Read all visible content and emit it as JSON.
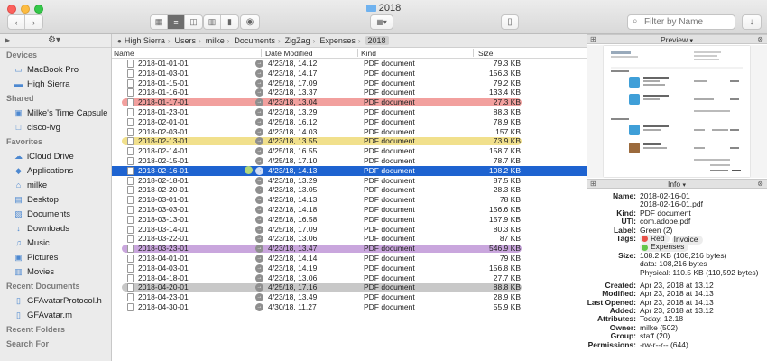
{
  "window": {
    "title": "2018"
  },
  "toolbar": {
    "search_placeholder": "Filter by Name"
  },
  "sidebar": {
    "sections": [
      {
        "title": "Devices",
        "items": [
          {
            "label": "MacBook Pro",
            "icon": "laptop-icon"
          },
          {
            "label": "High Sierra",
            "icon": "disk-icon"
          }
        ]
      },
      {
        "title": "Shared",
        "items": [
          {
            "label": "Milke's Time Capsule",
            "icon": "time-capsule-icon"
          },
          {
            "label": "cisco-lvg",
            "icon": "display-icon"
          }
        ]
      },
      {
        "title": "Favorites",
        "items": [
          {
            "label": "iCloud Drive",
            "icon": "cloud-icon"
          },
          {
            "label": "Applications",
            "icon": "applications-icon"
          },
          {
            "label": "milke",
            "icon": "home-icon"
          },
          {
            "label": "Desktop",
            "icon": "desktop-icon"
          },
          {
            "label": "Documents",
            "icon": "documents-icon"
          },
          {
            "label": "Downloads",
            "icon": "downloads-icon"
          },
          {
            "label": "Music",
            "icon": "music-icon"
          },
          {
            "label": "Pictures",
            "icon": "pictures-icon"
          },
          {
            "label": "Movies",
            "icon": "movies-icon"
          }
        ]
      },
      {
        "title": "Recent Documents",
        "items": [
          {
            "label": "GFAvatarProtocol.h",
            "icon": "file-icon"
          },
          {
            "label": "GFAvatar.m",
            "icon": "file-icon"
          }
        ]
      },
      {
        "title": "Recent Folders",
        "items": []
      },
      {
        "title": "Search For",
        "items": []
      }
    ]
  },
  "breadcrumb": [
    "High Sierra",
    "Users",
    "milke",
    "Documents",
    "ZigZag",
    "Expenses",
    "2018"
  ],
  "columns": {
    "name": "Name",
    "date": "Date Modified",
    "kind": "Kind",
    "size": "Size"
  },
  "files": [
    {
      "name": "2018-01-01-01",
      "date": "4/23/18, 14.12",
      "kind": "PDF document",
      "size": "79.3 KB"
    },
    {
      "name": "2018-01-03-01",
      "date": "4/23/18, 14.17",
      "kind": "PDF document",
      "size": "156.3 KB"
    },
    {
      "name": "2018-01-15-01",
      "date": "4/25/18, 17.09",
      "kind": "PDF document",
      "size": "79.2 KB"
    },
    {
      "name": "2018-01-16-01",
      "date": "4/23/18, 13.37",
      "kind": "PDF document",
      "size": "133.4 KB"
    },
    {
      "name": "2018-01-17-01",
      "date": "4/23/18, 13.04",
      "kind": "PDF document",
      "size": "27.3 KB",
      "label": "red"
    },
    {
      "name": "2018-01-23-01",
      "date": "4/23/18, 13.29",
      "kind": "PDF document",
      "size": "88.3 KB"
    },
    {
      "name": "2018-02-01-01",
      "date": "4/25/18, 16.12",
      "kind": "PDF document",
      "size": "78.9 KB"
    },
    {
      "name": "2018-02-03-01",
      "date": "4/23/18, 14.03",
      "kind": "PDF document",
      "size": "157 KB"
    },
    {
      "name": "2018-02-13-01",
      "date": "4/23/18, 13.55",
      "kind": "PDF document",
      "size": "73.9 KB",
      "label": "yellow"
    },
    {
      "name": "2018-02-14-01",
      "date": "4/25/18, 16.55",
      "kind": "PDF document",
      "size": "158.7 KB"
    },
    {
      "name": "2018-02-15-01",
      "date": "4/25/18, 17.10",
      "kind": "PDF document",
      "size": "78.7 KB"
    },
    {
      "name": "2018-02-16-01",
      "date": "4/23/18, 14.13",
      "kind": "PDF document",
      "size": "108.2 KB",
      "selected": true,
      "label": "green"
    },
    {
      "name": "2018-02-18-01",
      "date": "4/23/18, 13.29",
      "kind": "PDF document",
      "size": "87.5 KB"
    },
    {
      "name": "2018-02-20-01",
      "date": "4/23/18, 13.05",
      "kind": "PDF document",
      "size": "28.3 KB"
    },
    {
      "name": "2018-03-01-01",
      "date": "4/23/18, 14.13",
      "kind": "PDF document",
      "size": "78 KB"
    },
    {
      "name": "2018-03-03-01",
      "date": "4/23/18, 14.18",
      "kind": "PDF document",
      "size": "156.6 KB"
    },
    {
      "name": "2018-03-13-01",
      "date": "4/25/18, 16.58",
      "kind": "PDF document",
      "size": "157.9 KB"
    },
    {
      "name": "2018-03-14-01",
      "date": "4/25/18, 17.09",
      "kind": "PDF document",
      "size": "80.3 KB"
    },
    {
      "name": "2018-03-22-01",
      "date": "4/23/18, 13.06",
      "kind": "PDF document",
      "size": "87 KB"
    },
    {
      "name": "2018-03-23-01",
      "date": "4/23/18, 13.47",
      "kind": "PDF document",
      "size": "546.9 KB",
      "label": "purple"
    },
    {
      "name": "2018-04-01-01",
      "date": "4/23/18, 14.14",
      "kind": "PDF document",
      "size": "79 KB"
    },
    {
      "name": "2018-04-03-01",
      "date": "4/23/18, 14.19",
      "kind": "PDF document",
      "size": "156.8 KB"
    },
    {
      "name": "2018-04-18-01",
      "date": "4/23/18, 13.06",
      "kind": "PDF document",
      "size": "27.7 KB"
    },
    {
      "name": "2018-04-20-01",
      "date": "4/25/18, 17.16",
      "kind": "PDF document",
      "size": "88.8 KB",
      "label": "gray"
    },
    {
      "name": "2018-04-23-01",
      "date": "4/23/18, 13.49",
      "kind": "PDF document",
      "size": "28.9 KB"
    },
    {
      "name": "2018-04-30-01",
      "date": "4/30/18, 11.27",
      "kind": "PDF document",
      "size": "55.9 KB"
    }
  ],
  "label_colors": {
    "red": "#f2a09e",
    "yellow": "#f1e08c",
    "purple": "#c9a6dd",
    "gray": "#c8c8c8",
    "green": "#b4d87a"
  },
  "preview": {
    "title": "Preview"
  },
  "info": {
    "title": "Info",
    "name_label": "Name:",
    "name_value": "2018-02-16-01",
    "name_file": "2018-02-16-01.pdf",
    "kind_label": "Kind:",
    "kind_value": "PDF document",
    "uti_label": "UTI:",
    "uti_value": "com.adobe.pdf",
    "label_label": "Label:",
    "label_value": "Green (2)",
    "tags_label": "Tags:",
    "tags": [
      {
        "name": "Red",
        "color": "#e9524a"
      },
      {
        "name": "Invoice",
        "color": ""
      },
      {
        "name": "Expenses",
        "color": "#63c64a"
      }
    ],
    "size_label": "Size:",
    "size_value": "108.2 KB (108,216 bytes)",
    "size_data": "data: 108,216 bytes",
    "size_physical": "Physical: 110.5 KB (110,592 bytes)",
    "created_label": "Created:",
    "created_value": "Apr 23, 2018 at 13.12",
    "modified_label": "Modified:",
    "modified_value": "Apr 23, 2018 at 14.13",
    "opened_label": "Last Opened:",
    "opened_value": "Apr 23, 2018 at 14.13",
    "added_label": "Added:",
    "added_value": "Apr 23, 2018 at 13.12",
    "attributes_label": "Attributes:",
    "attributes_value": "Today, 12.18",
    "owner_label": "Owner:",
    "owner_value": "milke (502)",
    "group_label": "Group:",
    "group_value": "staff (20)",
    "perm_label": "Permissions:",
    "perm_value": "-rw-r--r-- (644)"
  }
}
